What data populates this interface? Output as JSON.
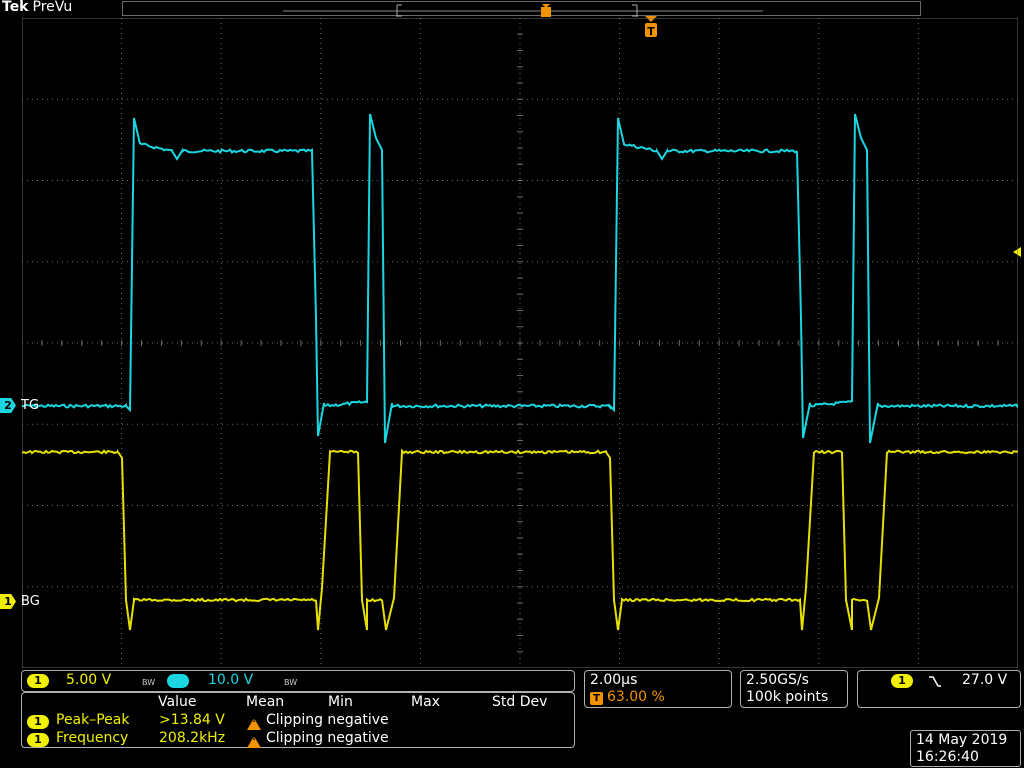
{
  "header": {
    "brand": "Tek",
    "mode": "PreVu"
  },
  "colors": {
    "ch1": "#f0f000",
    "ch2": "#1ad6e0",
    "trigger": "#f39200",
    "grid": "#6a6a6a",
    "background": "#000000"
  },
  "channels": [
    {
      "number": "2",
      "label": "TG",
      "color": "cyan"
    },
    {
      "number": "1",
      "label": "BG",
      "color": "yellow"
    }
  ],
  "trigger_marker": "T",
  "vertical": {
    "ch1_num": "1",
    "ch1_scale": "5.00 V",
    "ch2_num": "2",
    "ch2_scale": "10.0 V",
    "bw_symbol": "BW"
  },
  "timebase": {
    "scale": "2.00µs",
    "trigger_position": "63.00 %"
  },
  "acquisition": {
    "sample_rate": "2.50GS/s",
    "record_length": "100k points"
  },
  "trigger": {
    "source": "1",
    "slope_icon": "falling-edge-icon",
    "level": "27.0 V"
  },
  "measurements": {
    "headers": [
      "Value",
      "Mean",
      "Min",
      "Max",
      "Std Dev"
    ],
    "rows": [
      {
        "channel": "1",
        "name": "Peak–Peak",
        "value": ">13.84 V",
        "status": "Clipping negative"
      },
      {
        "channel": "1",
        "name": "Frequency",
        "value": "208.2kHz",
        "status": "Clipping negative"
      }
    ]
  },
  "datetime": {
    "date": "14 May 2019",
    "time": "16:26:40"
  },
  "chart_data": {
    "type": "line",
    "series": [
      {
        "name": "TG",
        "channel": 2
      },
      {
        "name": "BG",
        "channel": 1
      }
    ]
  }
}
